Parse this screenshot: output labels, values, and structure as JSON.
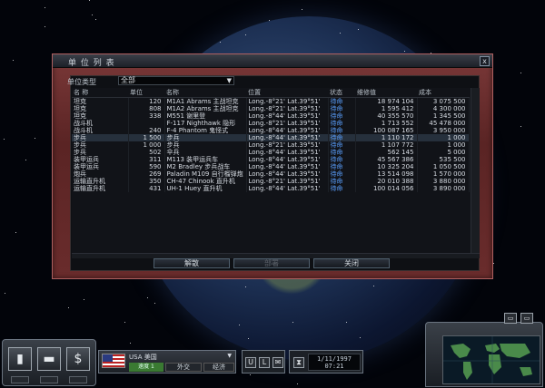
{
  "dialog": {
    "title": "单 位 列 表",
    "close_label": "x",
    "filter_label": "单位类型",
    "filter_value": "全部"
  },
  "table": {
    "headers": [
      "名 称",
      "单位",
      "名称",
      "位置",
      "状态",
      "维修值",
      "成本"
    ],
    "rows": [
      [
        "坦克",
        "120",
        "M1A1 Abrams 主战坦克",
        "Long.-8°21' Lat.39°51'",
        "待命",
        "18 974 104",
        "3 075 500"
      ],
      [
        "坦克",
        "808",
        "M1A2 Abrams 主战坦克",
        "Long.-8°21' Lat.39°51'",
        "待命",
        "1 595 412",
        "4 300 000"
      ],
      [
        "坦克",
        "338",
        "M551 谢里登",
        "Long.-8°44' Lat.39°51'",
        "待命",
        "40 355 570",
        "1 345 500"
      ],
      [
        "战斗机",
        "",
        "F-117 Nighthawk 隐形",
        "Long.-8°21' Lat.39°51'",
        "待命",
        "1 713 552",
        "45 478 000"
      ],
      [
        "战斗机",
        "240",
        "F-4 Phantom 鬼怪式",
        "Long.-8°44' Lat.39°51'",
        "待命",
        "100 087 165",
        "3 950 000"
      ],
      [
        "步兵",
        "1 500",
        "步兵",
        "Long.-8°44' Lat.39°51'",
        "待命",
        "1 110 172",
        "1 000"
      ],
      [
        "步兵",
        "1 000",
        "步兵",
        "Long.-8°21' Lat.39°51'",
        "待命",
        "1 107 772",
        "1 000"
      ],
      [
        "步兵",
        "502",
        "伞兵",
        "Long.-8°44' Lat.39°51'",
        "待命",
        "562 145",
        "5 000"
      ],
      [
        "装甲运兵",
        "311",
        "M113 装甲运兵车",
        "Long.-8°44' Lat.39°51'",
        "待命",
        "45 567 386",
        "535 500"
      ],
      [
        "装甲运兵",
        "590",
        "M2 Bradley 步兵战车",
        "Long.-8°44' Lat.39°51'",
        "待命",
        "10 325 204",
        "1 050 500"
      ],
      [
        "炮兵",
        "269",
        "Paladin M109 自行榴弹炮",
        "Long.-8°44' Lat.39°51'",
        "待命",
        "13 514 098",
        "1 570 000"
      ],
      [
        "运输直升机",
        "350",
        "CH-47 Chinook 直升机",
        "Long.-8°21' Lat.39°51'",
        "待命",
        "20 010 388",
        "3 880 000"
      ],
      [
        "运输直升机",
        "431",
        "UH-1 Huey 直升机",
        "Long.-8°44' Lat.39°51'",
        "待命",
        "100 014 056",
        "3 890 000"
      ]
    ],
    "selected_row": 5
  },
  "buttons": {
    "disband": "解散",
    "middle": "部署",
    "close": "关闭"
  },
  "hud": {
    "country": "USA 美国",
    "country_arrow": "▼",
    "speed": "速度 1",
    "btn_a": "外交",
    "btn_b": "经济",
    "tools": [
      "U",
      "L",
      "✉"
    ],
    "hourglass": "⧗",
    "date": "1/11/1997",
    "time": "07:21",
    "map_buttons": [
      "▭",
      "▭"
    ],
    "left_icons": [
      "▮",
      "▬",
      "$"
    ]
  },
  "colors": {
    "dialog_frame": "#6a2c2c",
    "status_blue": "#5aa0ff",
    "speed_green": "#3a7a32"
  }
}
